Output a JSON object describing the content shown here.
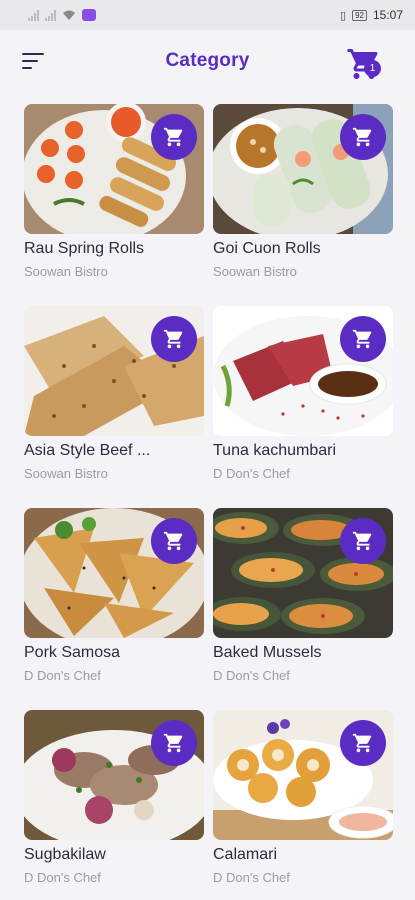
{
  "status_bar": {
    "time": "15:07",
    "battery": "92"
  },
  "header": {
    "title": "Category",
    "cart_count": "1"
  },
  "colors": {
    "accent": "#5a2cc4",
    "background": "#f4f4f8",
    "title_text": "#2b2b3c",
    "subtitle_text": "#9a9aa5"
  },
  "items": [
    {
      "name": "Rau Spring Rolls",
      "shop": "Soowan Bistro"
    },
    {
      "name": "Goi Cuon Rolls",
      "shop": "Soowan Bistro"
    },
    {
      "name": "Asia Style Beef ...",
      "shop": "Soowan Bistro"
    },
    {
      "name": "Tuna kachumbari",
      "shop": "D Don's Chef"
    },
    {
      "name": "Pork Samosa",
      "shop": "D Don's Chef"
    },
    {
      "name": "Baked Mussels",
      "shop": "D Don's Chef"
    },
    {
      "name": "Sugbakilaw",
      "shop": "D Don's Chef"
    },
    {
      "name": "Calamari",
      "shop": "D Don's Chef"
    }
  ]
}
